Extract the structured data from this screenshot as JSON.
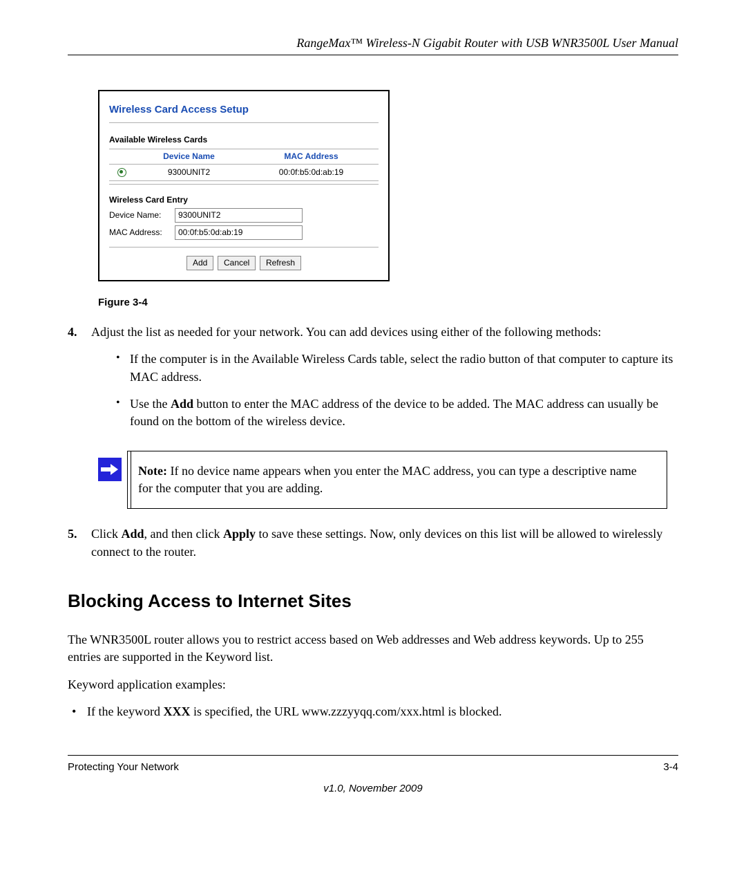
{
  "header": {
    "title": "RangeMax™ Wireless-N Gigabit Router with USB WNR3500L User Manual"
  },
  "screenshot": {
    "title": "Wireless Card Access Setup",
    "available": {
      "heading": "Available Wireless Cards",
      "cols": {
        "device": "Device Name",
        "mac": "MAC Address"
      },
      "row": {
        "device": "9300UNIT2",
        "mac": "00:0f:b5:0d:ab:19"
      }
    },
    "entry": {
      "heading": "Wireless Card Entry",
      "device_label": "Device Name:",
      "device_value": "9300UNIT2",
      "mac_label": "MAC Address:",
      "mac_value": "00:0f:b5:0d:ab:19"
    },
    "buttons": {
      "add": "Add",
      "cancel": "Cancel",
      "refresh": "Refresh"
    }
  },
  "figure_caption": "Figure 3-4",
  "steps": {
    "s4": {
      "num": "4.",
      "text": "Adjust the list as needed for your network. You can add devices using either of the following methods:",
      "b1": "If the computer is in the Available Wireless Cards table, select the radio button of that computer to capture its MAC address.",
      "b2_pre": "Use the ",
      "b2_bold": "Add",
      "b2_post": " button to enter the MAC address of the device to be added. The MAC address can usually be found on the bottom of the wireless device."
    },
    "s5": {
      "num": "5.",
      "pre": "Click ",
      "b1": "Add",
      "mid": ", and then click ",
      "b2": "Apply",
      "post": " to save these settings. Now, only devices on this list will be allowed to wirelessly connect to the router."
    }
  },
  "note": {
    "label": "Note:",
    "text": " If no device name appears when you enter the MAC address, you can type a descriptive name for the computer that you are adding."
  },
  "section": {
    "heading": "Blocking Access to Internet Sites",
    "p1": "The WNR3500L router allows you to restrict access based on Web addresses and Web address keywords. Up to 255 entries are supported in the Keyword list.",
    "p2": "Keyword application examples:",
    "bullet1_pre": "If the keyword ",
    "bullet1_bold": "XXX",
    "bullet1_post": " is specified, the URL www.zzzyyqq.com/xxx.html is blocked."
  },
  "footer": {
    "left": "Protecting Your Network",
    "right": "3-4",
    "version": "v1.0, November 2009"
  }
}
